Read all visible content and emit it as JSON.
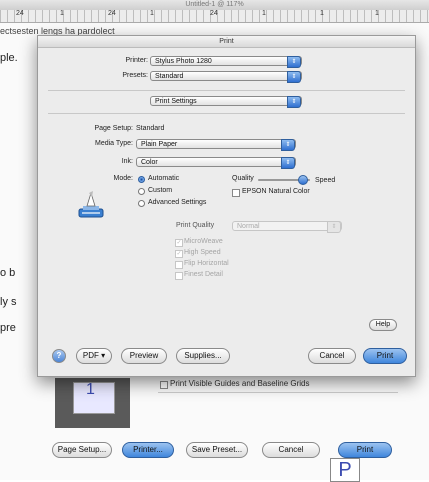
{
  "background": {
    "title": "Untitled-1 @ 117%",
    "ruler_ticks": [
      "24",
      "1",
      "24",
      "1",
      "24",
      "1",
      "1",
      "1"
    ],
    "garbled_text": "ectsesten lengs ha pardolect",
    "left_fragments": [
      "ple.",
      "o b",
      "ly s",
      "pre"
    ],
    "thumbnail_page": "1",
    "checkbox_label": "Print Visible Guides and Baseline Grids",
    "big_page_letter": "P",
    "buttons": {
      "page_setup": "Page Setup...",
      "printer": "Printer...",
      "save_preset": "Save Preset...",
      "cancel": "Cancel",
      "print": "Print"
    }
  },
  "dialog": {
    "title": "Print",
    "printer_label": "Printer:",
    "printer_value": "Stylus Photo 1280",
    "presets_label": "Presets:",
    "presets_value": "Standard",
    "pane_value": "Print Settings",
    "page_setup_label": "Page Setup:",
    "page_setup_value": "Standard",
    "media_type_label": "Media Type:",
    "media_type_value": "Plain Paper",
    "ink_label": "Ink:",
    "ink_value": "Color",
    "mode_label": "Mode:",
    "mode_options": [
      "Automatic",
      "Custom",
      "Advanced Settings"
    ],
    "quality_label": "Quality",
    "speed_label": "Speed",
    "quality_level": 0.85,
    "epson_natural_color": "EPSON Natural Color",
    "print_quality_label": "Print Quality",
    "print_quality_value": "Normal",
    "advanced_checks": [
      "MicroWeave",
      "High Speed",
      "Flip Horizontal",
      "Finest Detail"
    ],
    "help_button": "Help",
    "help_circle": "?",
    "pdf_button": "PDF ▾",
    "preview_button": "Preview",
    "supplies_button": "Supplies...",
    "cancel_button": "Cancel",
    "print_button": "Print"
  },
  "colors": {
    "accent_blue": "#3f86dc",
    "dialog_bg": "#ececec"
  }
}
